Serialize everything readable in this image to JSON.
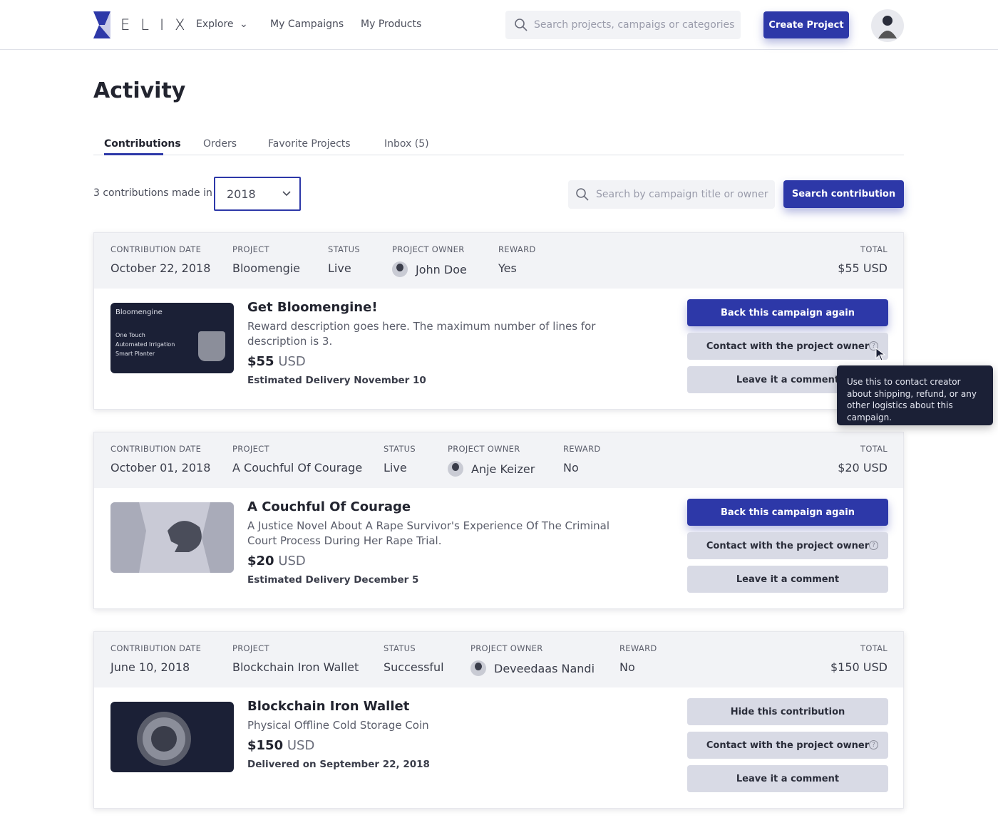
{
  "header": {
    "logo_text": "ELIX",
    "nav": [
      {
        "label": "Explore",
        "has_dropdown": true
      },
      {
        "label": "My Campaigns"
      },
      {
        "label": "My Products"
      }
    ],
    "search_placeholder": "Search projects, campaigs or categories",
    "create_button": "Create Project"
  },
  "page": {
    "title": "Activity",
    "tabs": [
      {
        "label": "Contributions",
        "active": true
      },
      {
        "label": "Orders"
      },
      {
        "label": "Favorite Projects"
      },
      {
        "label": "Inbox (5)"
      }
    ],
    "filter_label": "3 contributions made in",
    "year": "2018",
    "search_placeholder": "Search by campaign title or owner",
    "search_button": "Search contribution"
  },
  "columns": {
    "date": "CONTRIBUTION DATE",
    "project": "PROJECT",
    "status": "STATUS",
    "owner": "PROJECT OWNER",
    "reward": "REWARD",
    "total": "TOTAL"
  },
  "contributions": [
    {
      "date": "October 22, 2018",
      "project": "Bloomengie",
      "status": "Live",
      "owner": "John Doe",
      "reward": "Yes",
      "total": "$55 USD",
      "title": "Get Bloomengine!",
      "description": "Reward description goes here. The maximum number of lines for description is 3.",
      "price": "$55",
      "currency": "USD",
      "delivery": "Estimated Delivery November 10",
      "thumb": {
        "brand": "Bloomengine",
        "lines": [
          "One Touch",
          "Automated Irrigation",
          "Smart Planter"
        ]
      },
      "actions": [
        "Back this campaign again",
        "Contact with the project owner",
        "Leave it a comment"
      ]
    },
    {
      "date": "October 01, 2018",
      "project": "A Couchful Of Courage",
      "status": "Live",
      "owner": "Anje Keizer",
      "reward": "No",
      "total": "$20 USD",
      "title": "A Couchful Of Courage",
      "description": "A Justice Novel About A Rape Survivor's Experience Of The Criminal Court Process During Her Rape Trial.",
      "price": "$20",
      "currency": "USD",
      "delivery": "Estimated Delivery December 5",
      "actions": [
        "Back this campaign again",
        "Contact with the project owner",
        "Leave it a comment"
      ]
    },
    {
      "date": "June 10, 2018",
      "project": "Blockchain Iron Wallet",
      "status": "Successful",
      "owner": "Deveedaas Nandi",
      "reward": "No",
      "total": "$150 USD",
      "title": "Blockchain Iron Wallet",
      "description": "Physical Offline Cold Storage Coin",
      "price": "$150",
      "currency": "USD",
      "delivery": "Delivered on September 22, 2018",
      "actions": [
        "Hide this contribution",
        "Contact with the project owner",
        "Leave it a comment"
      ]
    }
  ],
  "tooltip": "Use this to contact creator about shipping, refund, or any other logistics about this campaign.",
  "colors": {
    "primary": "#2d38a8",
    "secondary_button": "#d8dae5",
    "card_header": "#f2f3f6",
    "tooltip": "#1b2036"
  }
}
